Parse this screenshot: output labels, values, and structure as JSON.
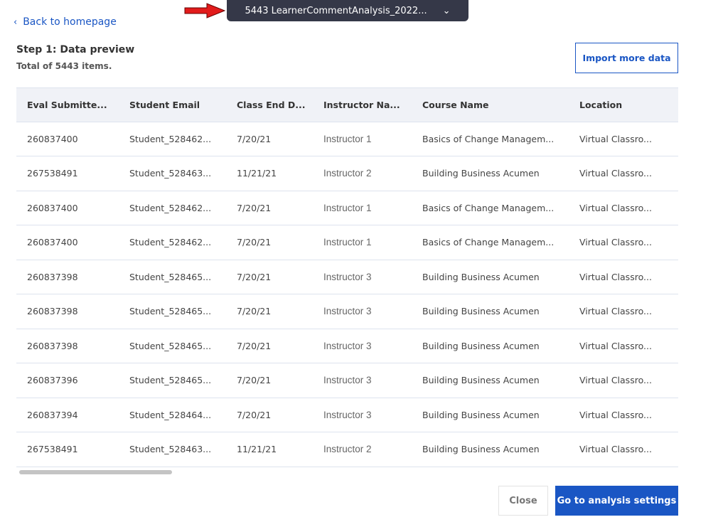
{
  "back_label": "Back to homepage",
  "file_selector": {
    "label": "5443 LearnerCommentAnalysis_2022..."
  },
  "title": "Step 1: Data preview",
  "subtitle": "Total of 5443 items.",
  "import_label": "Import more data",
  "columns": [
    "Eval Submitte...",
    "Student Email",
    "Class End D...",
    "Instructor Na...",
    "Course Name",
    "Location"
  ],
  "rows": [
    [
      "260837400",
      "Student_528462...",
      "7/20/21",
      "Instructor 1",
      "Basics of Change Managem...",
      "Virtual Classro..."
    ],
    [
      "267538491",
      "Student_528463...",
      "11/21/21",
      "Instructor 2",
      "Building Business Acumen",
      "Virtual Classro..."
    ],
    [
      "260837400",
      "Student_528462...",
      "7/20/21",
      "Instructor 1",
      "Basics of Change Managem...",
      "Virtual Classro..."
    ],
    [
      "260837400",
      "Student_528462...",
      "7/20/21",
      "Instructor 1",
      "Basics of Change Managem...",
      "Virtual Classro..."
    ],
    [
      "260837398",
      "Student_528465...",
      "7/20/21",
      "Instructor 3",
      "Building Business Acumen",
      "Virtual Classro..."
    ],
    [
      "260837398",
      "Student_528465...",
      "7/20/21",
      "Instructor 3",
      "Building Business Acumen",
      "Virtual Classro..."
    ],
    [
      "260837398",
      "Student_528465...",
      "7/20/21",
      "Instructor 3",
      "Building Business Acumen",
      "Virtual Classro..."
    ],
    [
      "260837396",
      "Student_528465...",
      "7/20/21",
      "Instructor 3",
      "Building Business Acumen",
      "Virtual Classro..."
    ],
    [
      "260837394",
      "Student_528464...",
      "7/20/21",
      "Instructor 3",
      "Building Business Acumen",
      "Virtual Classro..."
    ],
    [
      "267538491",
      "Student_528463...",
      "11/21/21",
      "Instructor 2",
      "Building Business Acumen",
      "Virtual Classro..."
    ]
  ],
  "close_label": "Close",
  "go_label": "Go to analysis settings"
}
